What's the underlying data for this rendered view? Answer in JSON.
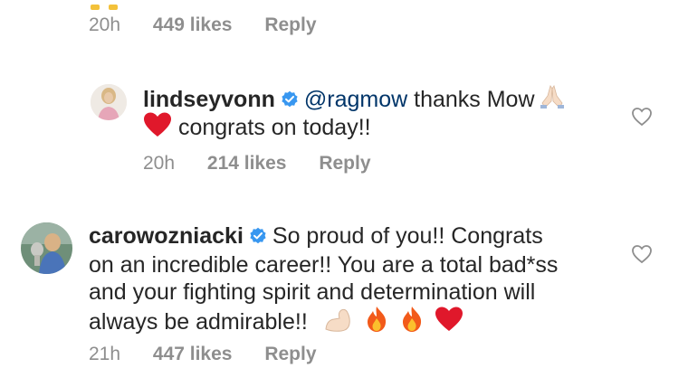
{
  "top_meta": {
    "time": "20h",
    "likes": "449 likes",
    "reply": "Reply"
  },
  "reply_comment": {
    "username": "lindseyvonn",
    "mention": "@ragmow",
    "text1": " thanks Mow",
    "text2": " congrats on today!!",
    "time": "20h",
    "likes": "214 likes",
    "reply": "Reply"
  },
  "main_comment": {
    "username": "carowozniacki",
    "line1": "So proud of you!! Congrats",
    "line2": "on an incredible career!! You are a total bad*ss",
    "line3": "and your fighting spirit and determination will",
    "line4": "always be admirable!!",
    "time": "21h",
    "likes": "447 likes",
    "reply": "Reply"
  },
  "colors": {
    "text": "#262626",
    "muted": "#8e8e8e",
    "verified": "#3897f0",
    "mention": "#003569"
  },
  "icons": [
    "verified-badge-icon",
    "heart-outline-icon",
    "praying-hands-emoji",
    "red-heart-emoji",
    "flexed-biceps-emoji",
    "fire-emoji"
  ]
}
